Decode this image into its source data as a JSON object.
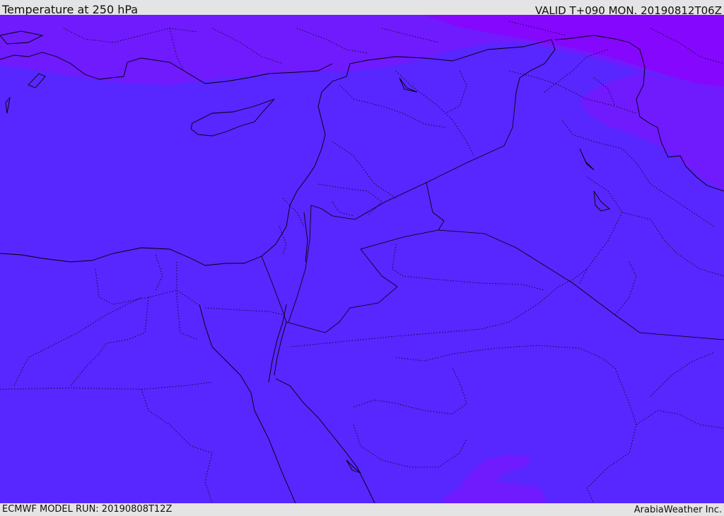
{
  "header": {
    "title": "Temperature at 250 hPa",
    "valid": "VALID T+090 MON. 20190812T06Z"
  },
  "footer": {
    "model_run": "ECMWF MODEL RUN: 20190808T12Z",
    "credit": "ArabiaWeather Inc."
  },
  "colors": {
    "base_fill": "#5826fe",
    "colder_band": "#6f1bfe",
    "coldest_band": "#8507fe",
    "boundary_line": "#000000",
    "background": "#e4e4e4"
  }
}
